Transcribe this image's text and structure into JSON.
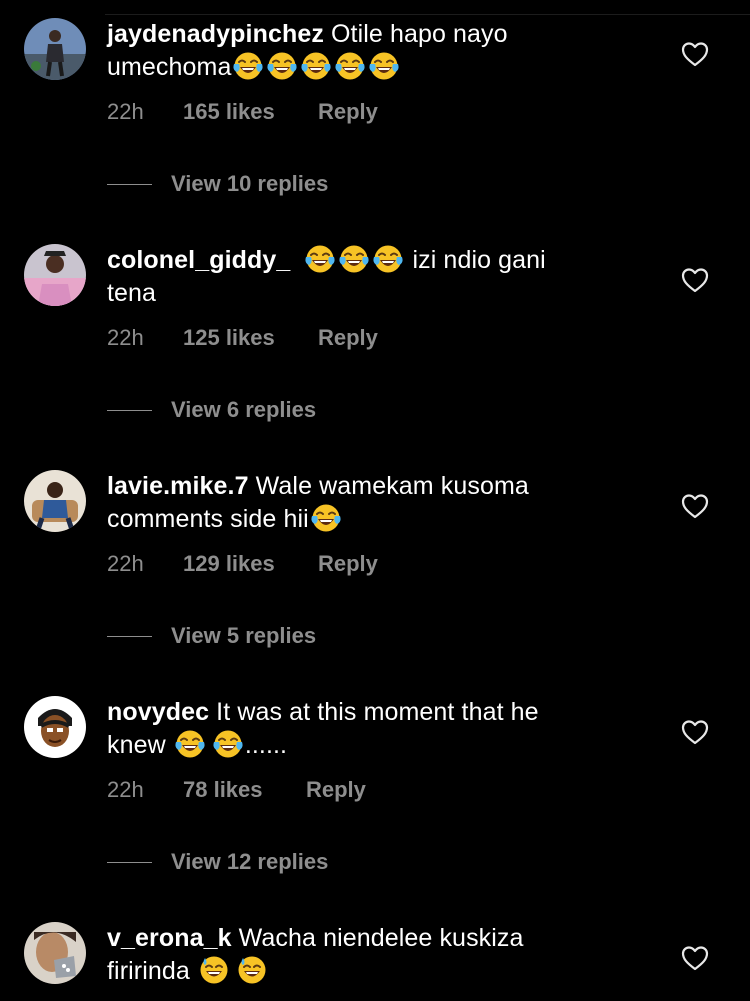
{
  "comments": [
    {
      "username": "jaydenadypinchez",
      "line1_text": " Otile hapo nayo",
      "line2_text": "umechoma",
      "line2_emojis": [
        "tears-of-joy",
        "tears-of-joy",
        "tears-of-joy",
        "tears-of-joy",
        "tears-of-joy"
      ],
      "time": "22h",
      "likes": "165 likes",
      "reply": "Reply",
      "view_replies": "View 10 replies"
    },
    {
      "username": "colonel_giddy_",
      "line1_emojis": [
        "tears-of-joy",
        "tears-of-joy",
        "tears-of-joy"
      ],
      "line1_text": " izi ndio gani",
      "line2_text": "tena",
      "time": "22h",
      "likes": "125 likes",
      "reply": "Reply",
      "view_replies": "View 6 replies"
    },
    {
      "username": "lavie.mike.7",
      "line1_text": " Wale wamekam kusoma",
      "line2_text": "comments side hii",
      "line2_emojis": [
        "tears-of-joy"
      ],
      "time": "22h",
      "likes": "129 likes",
      "reply": "Reply",
      "view_replies": "View 5 replies"
    },
    {
      "username": "novydec",
      "line1_text": " It was at this moment that he",
      "line2_text": "knew ",
      "line2_emojis": [
        "tears-of-joy",
        "tears-of-joy"
      ],
      "line2_suffix": "......",
      "time": "22h",
      "likes": "78 likes",
      "reply": "Reply",
      "view_replies": "View 12 replies"
    },
    {
      "username": "v_erona_k",
      "line1_text": " Wacha niendelee kuskiza",
      "line2_text": "firirinda ",
      "line2_emojis": [
        "grinning-sweat",
        "grinning-sweat"
      ]
    }
  ],
  "icons": {
    "like": "heart-outline-icon"
  },
  "colors": {
    "background": "#000000",
    "text": "#ffffff",
    "secondary": "#8e8e8e"
  }
}
